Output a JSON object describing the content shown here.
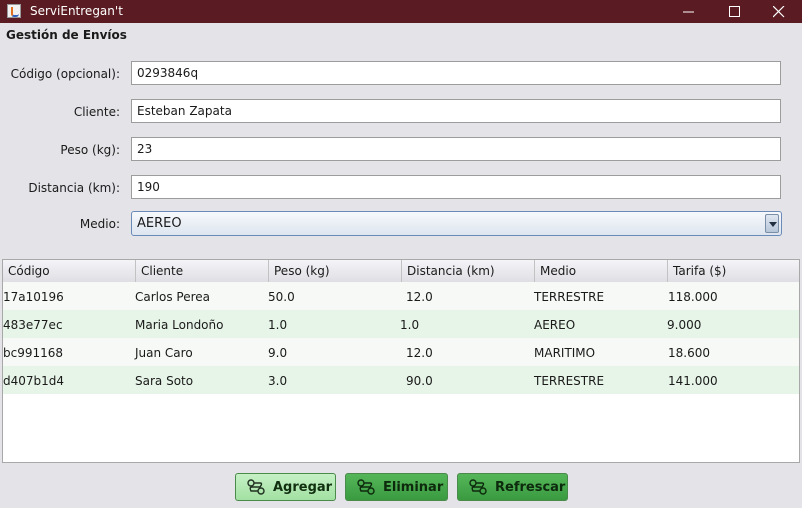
{
  "window": {
    "title": "ServiEntregan't"
  },
  "section_title": "Gestión de Envíos",
  "form": {
    "codigo_label": "Código (opcional):",
    "codigo_value": "0293846q",
    "cliente_label": "Cliente:",
    "cliente_value": "Esteban Zapata",
    "peso_label": "Peso (kg):",
    "peso_value": "23",
    "distancia_label": "Distancia (km):",
    "distancia_value": "190",
    "medio_label": "Medio:",
    "medio_value": "AEREO"
  },
  "table": {
    "columns": [
      "Código",
      "Cliente",
      "Peso (kg)",
      "Distancia (km)",
      "Medio",
      "Tarifa ($)"
    ],
    "rows": [
      [
        "17a10196",
        "Carlos Perea",
        "50.0",
        "12.0",
        "TERRESTRE",
        "118.000"
      ],
      [
        "483e77ec",
        "Maria Londoño",
        "1.0",
        "1.0",
        "AEREO",
        "9.000"
      ],
      [
        "bc991168",
        "Juan Caro",
        "9.0",
        "12.0",
        "MARITIMO",
        "18.600"
      ],
      [
        "d407b1d4",
        "Sara Soto",
        "3.0",
        "90.0",
        "TERRESTRE",
        "141.000"
      ]
    ]
  },
  "buttons": {
    "agregar": "Agregar",
    "eliminar": "Eliminar",
    "refrescar": "Refrescar"
  },
  "icons": {
    "app": "java-cup-icon",
    "buttons": "route-path-icon"
  },
  "colors": {
    "titlebar": "#5a1c22",
    "row_alt": "#e7f5e8",
    "button_green": "#3b9a40",
    "button_light": "#a2e0a2"
  }
}
